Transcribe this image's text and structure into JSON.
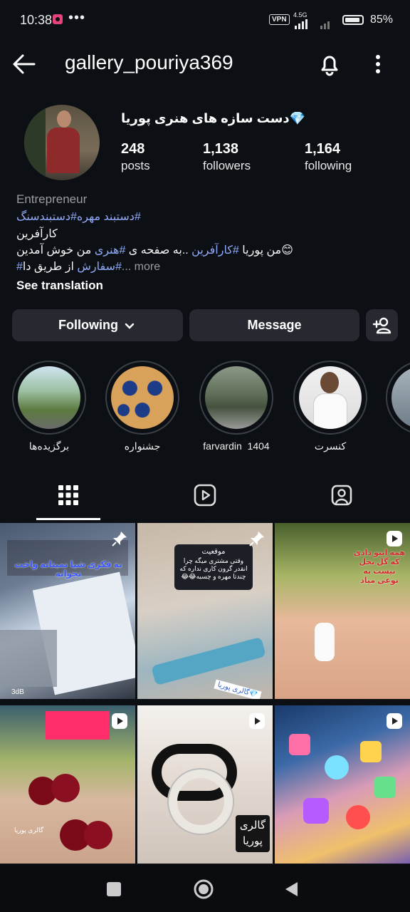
{
  "status_bar": {
    "time": "10:38",
    "dots": "•••",
    "vpn": "VPN",
    "network": "4.5G",
    "battery": "85%"
  },
  "header": {
    "username": "gallery_pouriya369",
    "icons": [
      "back-arrow-icon",
      "bell-icon",
      "more-vertical-icon"
    ]
  },
  "profile": {
    "display_name": "💎دست سازه های هنری پوریا",
    "posts_count": "248",
    "posts_label": "posts",
    "followers_count": "1,138",
    "followers_label": "followers",
    "following_count": "1,164",
    "following_label": "following",
    "category": "Entrepreneur",
    "bio": {
      "line1_tag1": "#دستبندسنگ",
      "line1_tag2": "#دستبند مهره",
      "line2": "کارآفرین",
      "line3_prefix": "😊من پوریا ",
      "line3_tag1": "#کارآفرین",
      "line3_mid": " ..به صفحه ی ",
      "line3_tag2": "#هنری",
      "line3_suffix": " من خوش آمدین",
      "line4_tag": "#سفارش",
      "line4_text": " از طریق دا",
      "more": "... more"
    },
    "see_translation": "See translation"
  },
  "actions": {
    "following": "Following",
    "message": "Message",
    "add_user_icon": "add-person-icon"
  },
  "highlights": [
    {
      "label": "برگزیده‌ها"
    },
    {
      "label": "جشنواره"
    },
    {
      "label": "farvardin  1404"
    },
    {
      "label": "کنسرت"
    },
    {
      "label": ""
    }
  ],
  "tabs": [
    "grid-icon",
    "reels-icon",
    "tagged-icon"
  ],
  "grid": {
    "c1_text": "به فکری شیا نمیتانه واخت نجوانه",
    "c1_corner": "3dB",
    "c2_text_1": "موقعیت",
    "c2_text_2": "وقتی مشتری میگه چرا انقدر گرون کاری نداره که چندتا مهره و چسبه😂😂",
    "c2_watermark": "💎گالری پوریا",
    "c3_text": "همه اینو دادی که گل بحل نیست به نوعی میاد",
    "c4_watermark": "گالری پوریا",
    "c5_watermark_1": "گالری",
    "c5_watermark_2": "پوریا"
  },
  "colors": {
    "background": "#0c0f14",
    "button": "#262a30",
    "hashtag": "#8fa9f7"
  }
}
